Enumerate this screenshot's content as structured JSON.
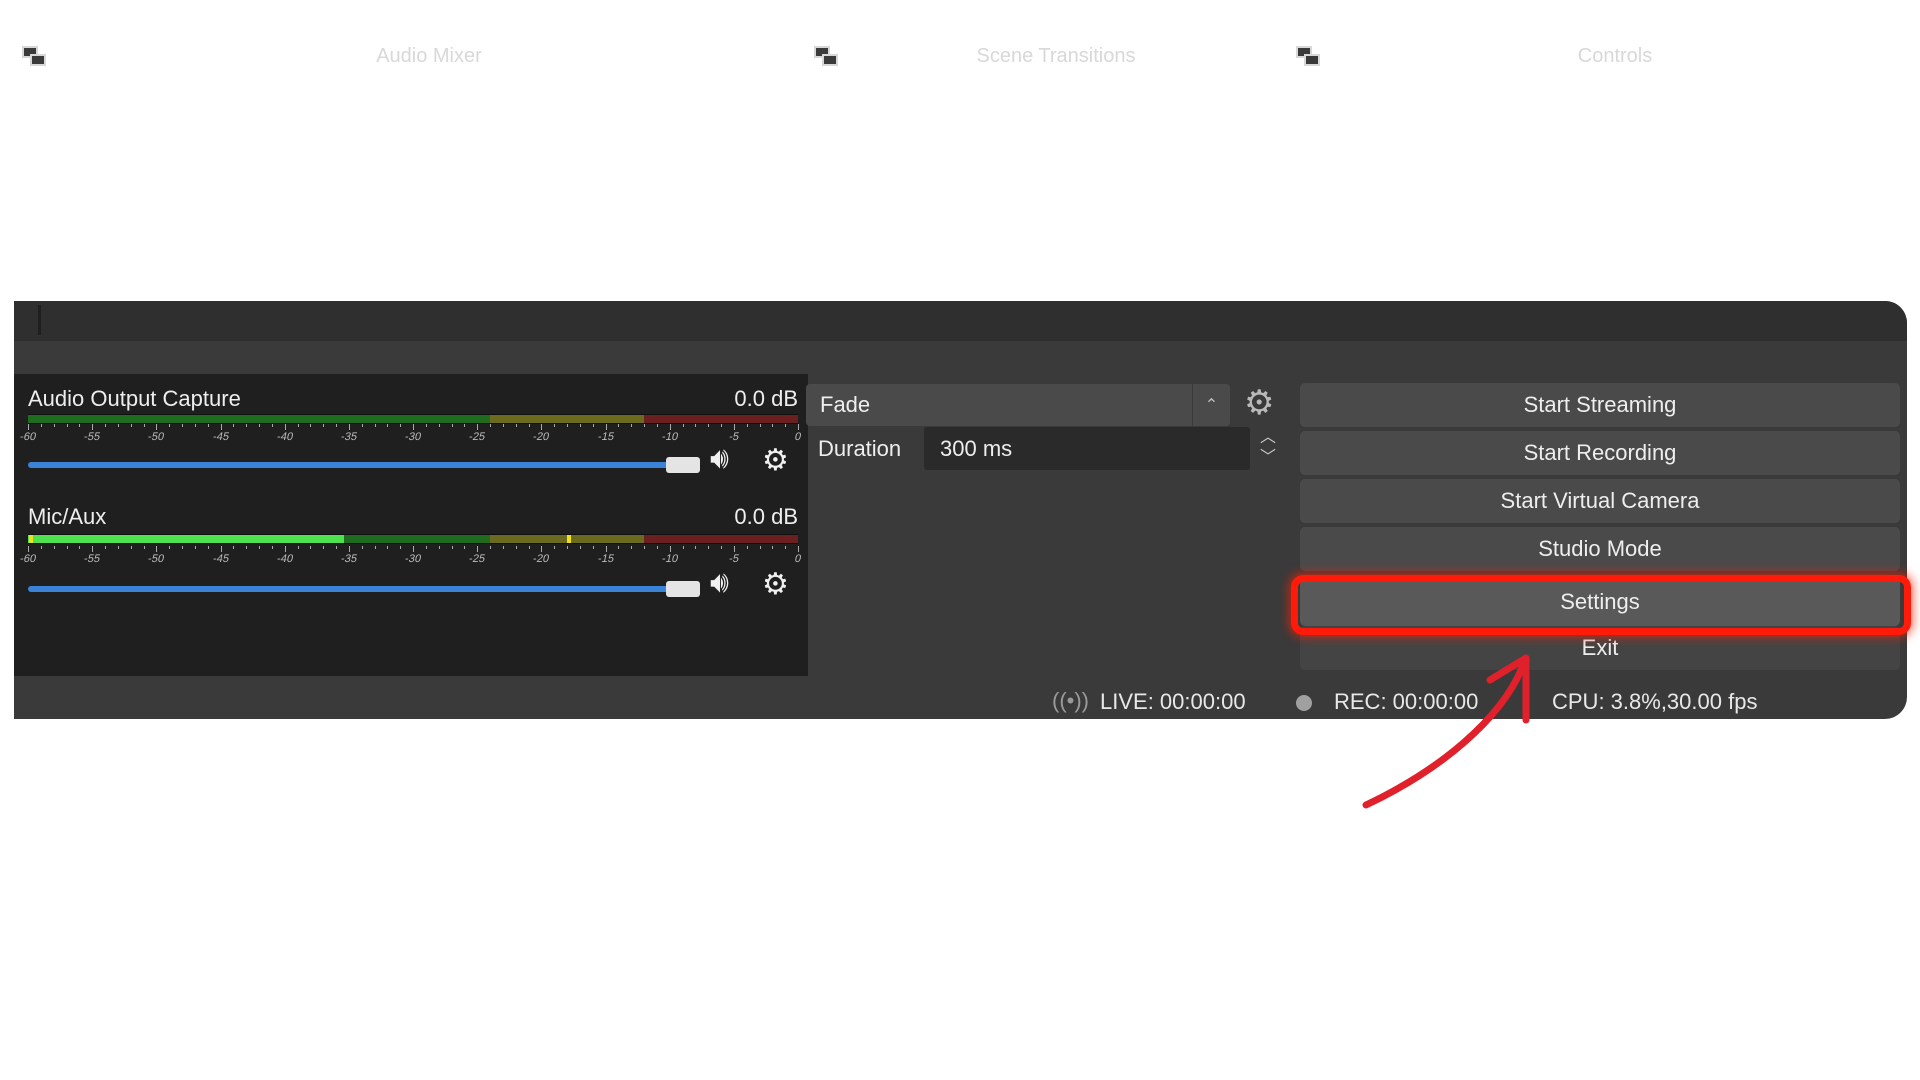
{
  "docks": {
    "audio_mixer": "Audio Mixer",
    "scene_transitions": "Scene Transitions",
    "controls": "Controls"
  },
  "mixer": {
    "sources": [
      {
        "name": "Audio Output Capture",
        "db": "0.0 dB",
        "volume_fraction": 0.98,
        "level_fraction": 0.0
      },
      {
        "name": "Mic/Aux",
        "db": "0.0 dB",
        "volume_fraction": 0.98,
        "level_fraction": 0.41
      }
    ],
    "scale_labels": [
      "-60",
      "-55",
      "-50",
      "-45",
      "-40",
      "-35",
      "-30",
      "-25",
      "-20",
      "-15",
      "-10",
      "-5",
      "0"
    ],
    "icons": {
      "mute": "speaker-icon",
      "properties": "gear-icon"
    }
  },
  "transitions": {
    "selected": "Fade",
    "duration_label": "Duration",
    "duration_value": "300 ms"
  },
  "controls": {
    "start_streaming": "Start Streaming",
    "start_recording": "Start Recording",
    "start_virtual_camera": "Start Virtual Camera",
    "studio_mode": "Studio Mode",
    "settings": "Settings",
    "exit": "Exit"
  },
  "status": {
    "live": "LIVE: 00:00:00",
    "rec": "REC: 00:00:00",
    "cpu": "CPU: 3.8%,30.00 fps"
  },
  "colors": {
    "highlight": "#ff1a0a",
    "arrow": "#e0202a",
    "fader": "#3a83d8"
  }
}
